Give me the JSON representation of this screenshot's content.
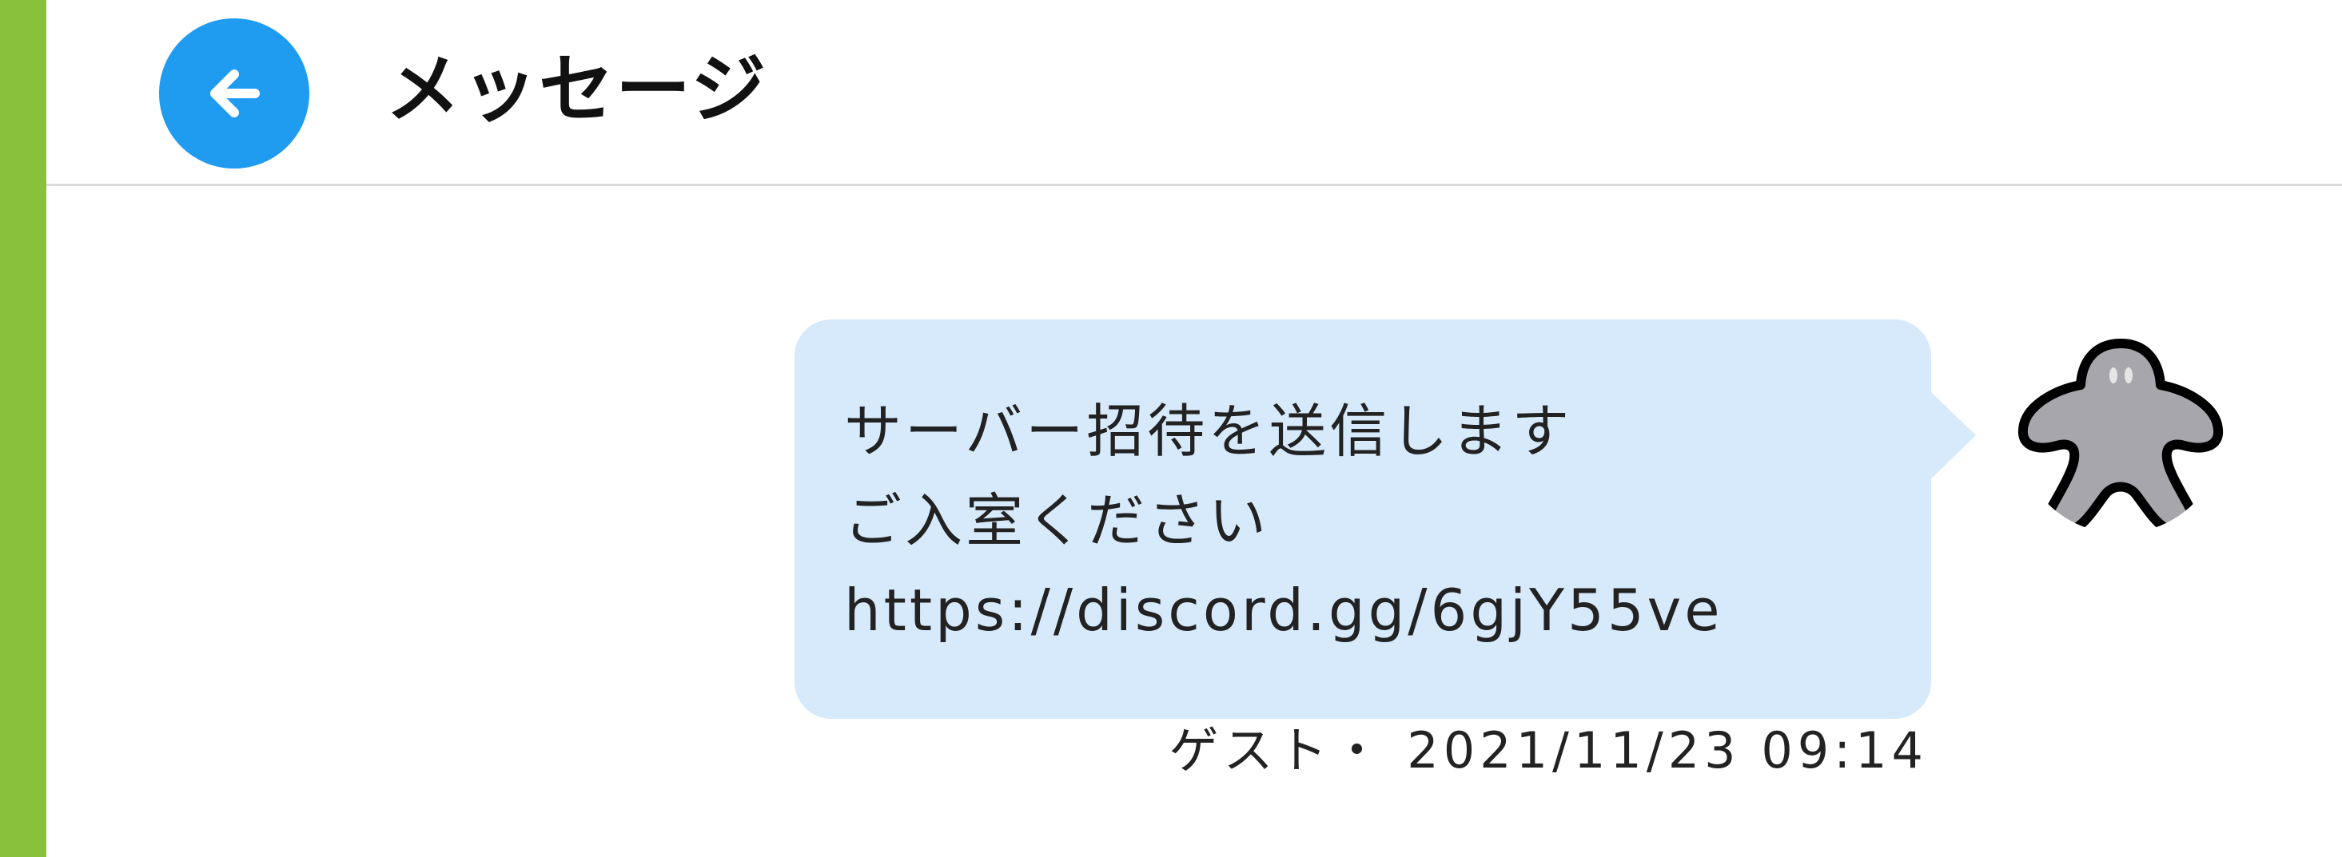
{
  "header": {
    "title": "メッセージ",
    "back_icon": "arrow-left-icon"
  },
  "message": {
    "lines": [
      "サーバー招待を送信します",
      "ご入室ください",
      "https://discord.gg/6gjY55ve"
    ],
    "sender": "ゲスト",
    "separator": "・",
    "timestamp": "2021/11/23 09:14",
    "avatar_icon": "meeple-icon"
  },
  "colors": {
    "accent_bar": "#8ac13c",
    "back_button": "#1f9bf0",
    "bubble": "#d6eafc",
    "meeple": "#a7a6ac"
  }
}
